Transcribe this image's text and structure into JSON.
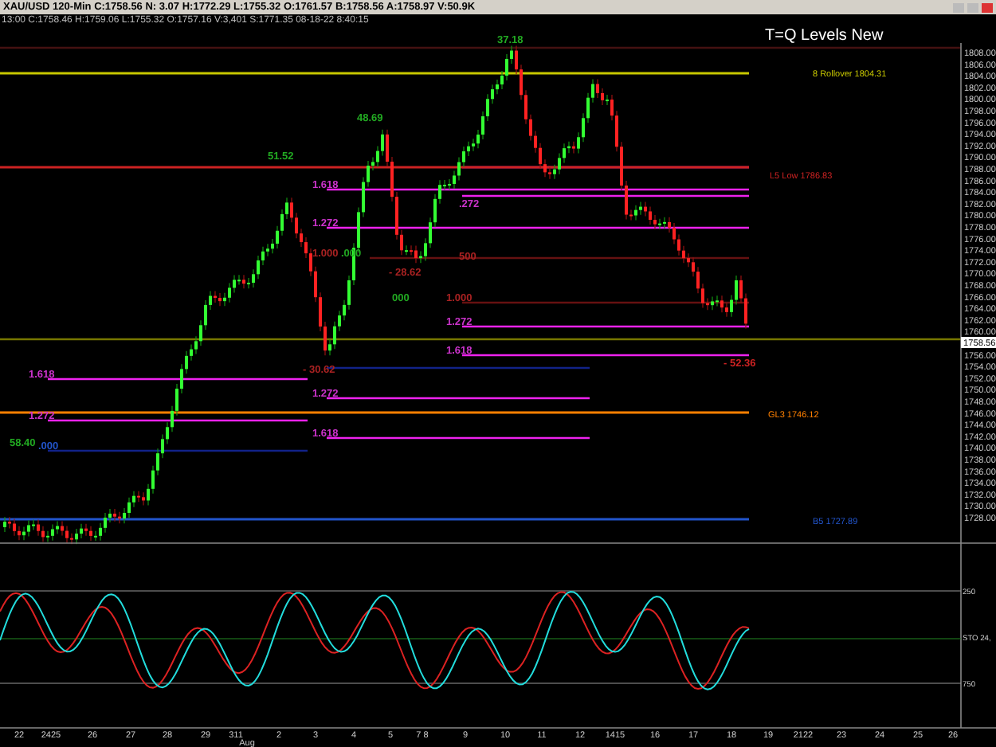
{
  "window": {
    "title": "XAU/USD 120-Min C:1758.56 N: 3.07 H:1772.29 L:1755.32 O:1761.57 B:1758.56 A:1758.97 V:50.9K"
  },
  "info_bar": {
    "text": "13:00 C:1758.46 H:1759.06 L:1755.32 O:1757.16 V:3,401 S:1771.35 08-18-22 8:40:15"
  },
  "chart": {
    "title": "T=Q Levels New",
    "price_axis": [
      "1808.00",
      "1806.00",
      "1804.00",
      "1802.00",
      "1800.00",
      "1798.00",
      "1796.00",
      "1794.00",
      "1792.00",
      "1790.00",
      "1788.00",
      "1786.00",
      "1784.00",
      "1782.00",
      "1780.00",
      "1778.00",
      "1776.00",
      "1774.00",
      "1772.00",
      "1770.00",
      "1768.00",
      "1766.00",
      "1764.00",
      "1762.00",
      "1760.00",
      "1756.00",
      "1754.00",
      "1752.00",
      "1750.00",
      "1748.00",
      "1746.00",
      "1744.00",
      "1742.00",
      "1740.00",
      "1738.00",
      "1736.00",
      "1734.00",
      "1732.00",
      "1730.00",
      "1728.00"
    ],
    "current_price": "1758.56",
    "levels": [
      {
        "label": "8 Rollover 1804.31",
        "color": "#c8c800"
      },
      {
        "label": "L5 Low 1786.83",
        "color": "#cc2222"
      },
      {
        "label": "GL3 1746.12",
        "color": "#ff8000"
      },
      {
        "label": "B5 1727.89",
        "color": "#2255cc"
      }
    ],
    "fib_labels": [
      {
        "text": "1.618",
        "color": "#cc33cc"
      },
      {
        "text": "1.272",
        "color": "#cc33cc"
      },
      {
        "text": "1.000",
        "color": "#aa2222"
      },
      {
        "text": ".000",
        "color": "#22aa22"
      },
      {
        "text": "- 28.62",
        "color": "#aa2222"
      },
      {
        "text": "000",
        "color": "#22aa22"
      },
      {
        "text": ".272",
        "color": "#cc33cc"
      },
      {
        "text": "500",
        "color": "#aa2222"
      },
      {
        "text": "1.000",
        "color": "#aa2222"
      },
      {
        "text": "1.272",
        "color": "#cc33cc"
      },
      {
        "text": "1.618",
        "color": "#cc33cc"
      },
      {
        "text": "- 30.62",
        "color": "#aa2222"
      },
      {
        "text": "1.618",
        "color": "#cc33cc"
      },
      {
        "text": "1.272",
        "color": "#cc33cc"
      },
      {
        "text": "1.272",
        "color": "#cc33cc"
      },
      {
        "text": "1.618",
        "color": "#cc33cc"
      },
      {
        "text": "58.40",
        "color": "#22aa22"
      },
      {
        "text": ".000",
        "color": "#2255cc"
      },
      {
        "text": "- 52.36",
        "color": "#cc2222"
      },
      {
        "text": "51.52",
        "color": "#22aa22"
      },
      {
        "text": "48.69",
        "color": "#22aa22"
      },
      {
        "text": "37.18",
        "color": "#22aa22"
      }
    ]
  },
  "oscillator": {
    "axis": [
      "250",
      "STO 24,",
      "750"
    ]
  },
  "time_axis": {
    "labels": [
      "22",
      "2425",
      "26",
      "27",
      "28",
      "29",
      "311",
      "2",
      "3",
      "4",
      "5",
      "7 8",
      "9",
      "10",
      "11",
      "12",
      "1415",
      "16",
      "17",
      "18",
      "19",
      "2122",
      "23",
      "24",
      "25",
      "26"
    ],
    "month": "Aug"
  }
}
